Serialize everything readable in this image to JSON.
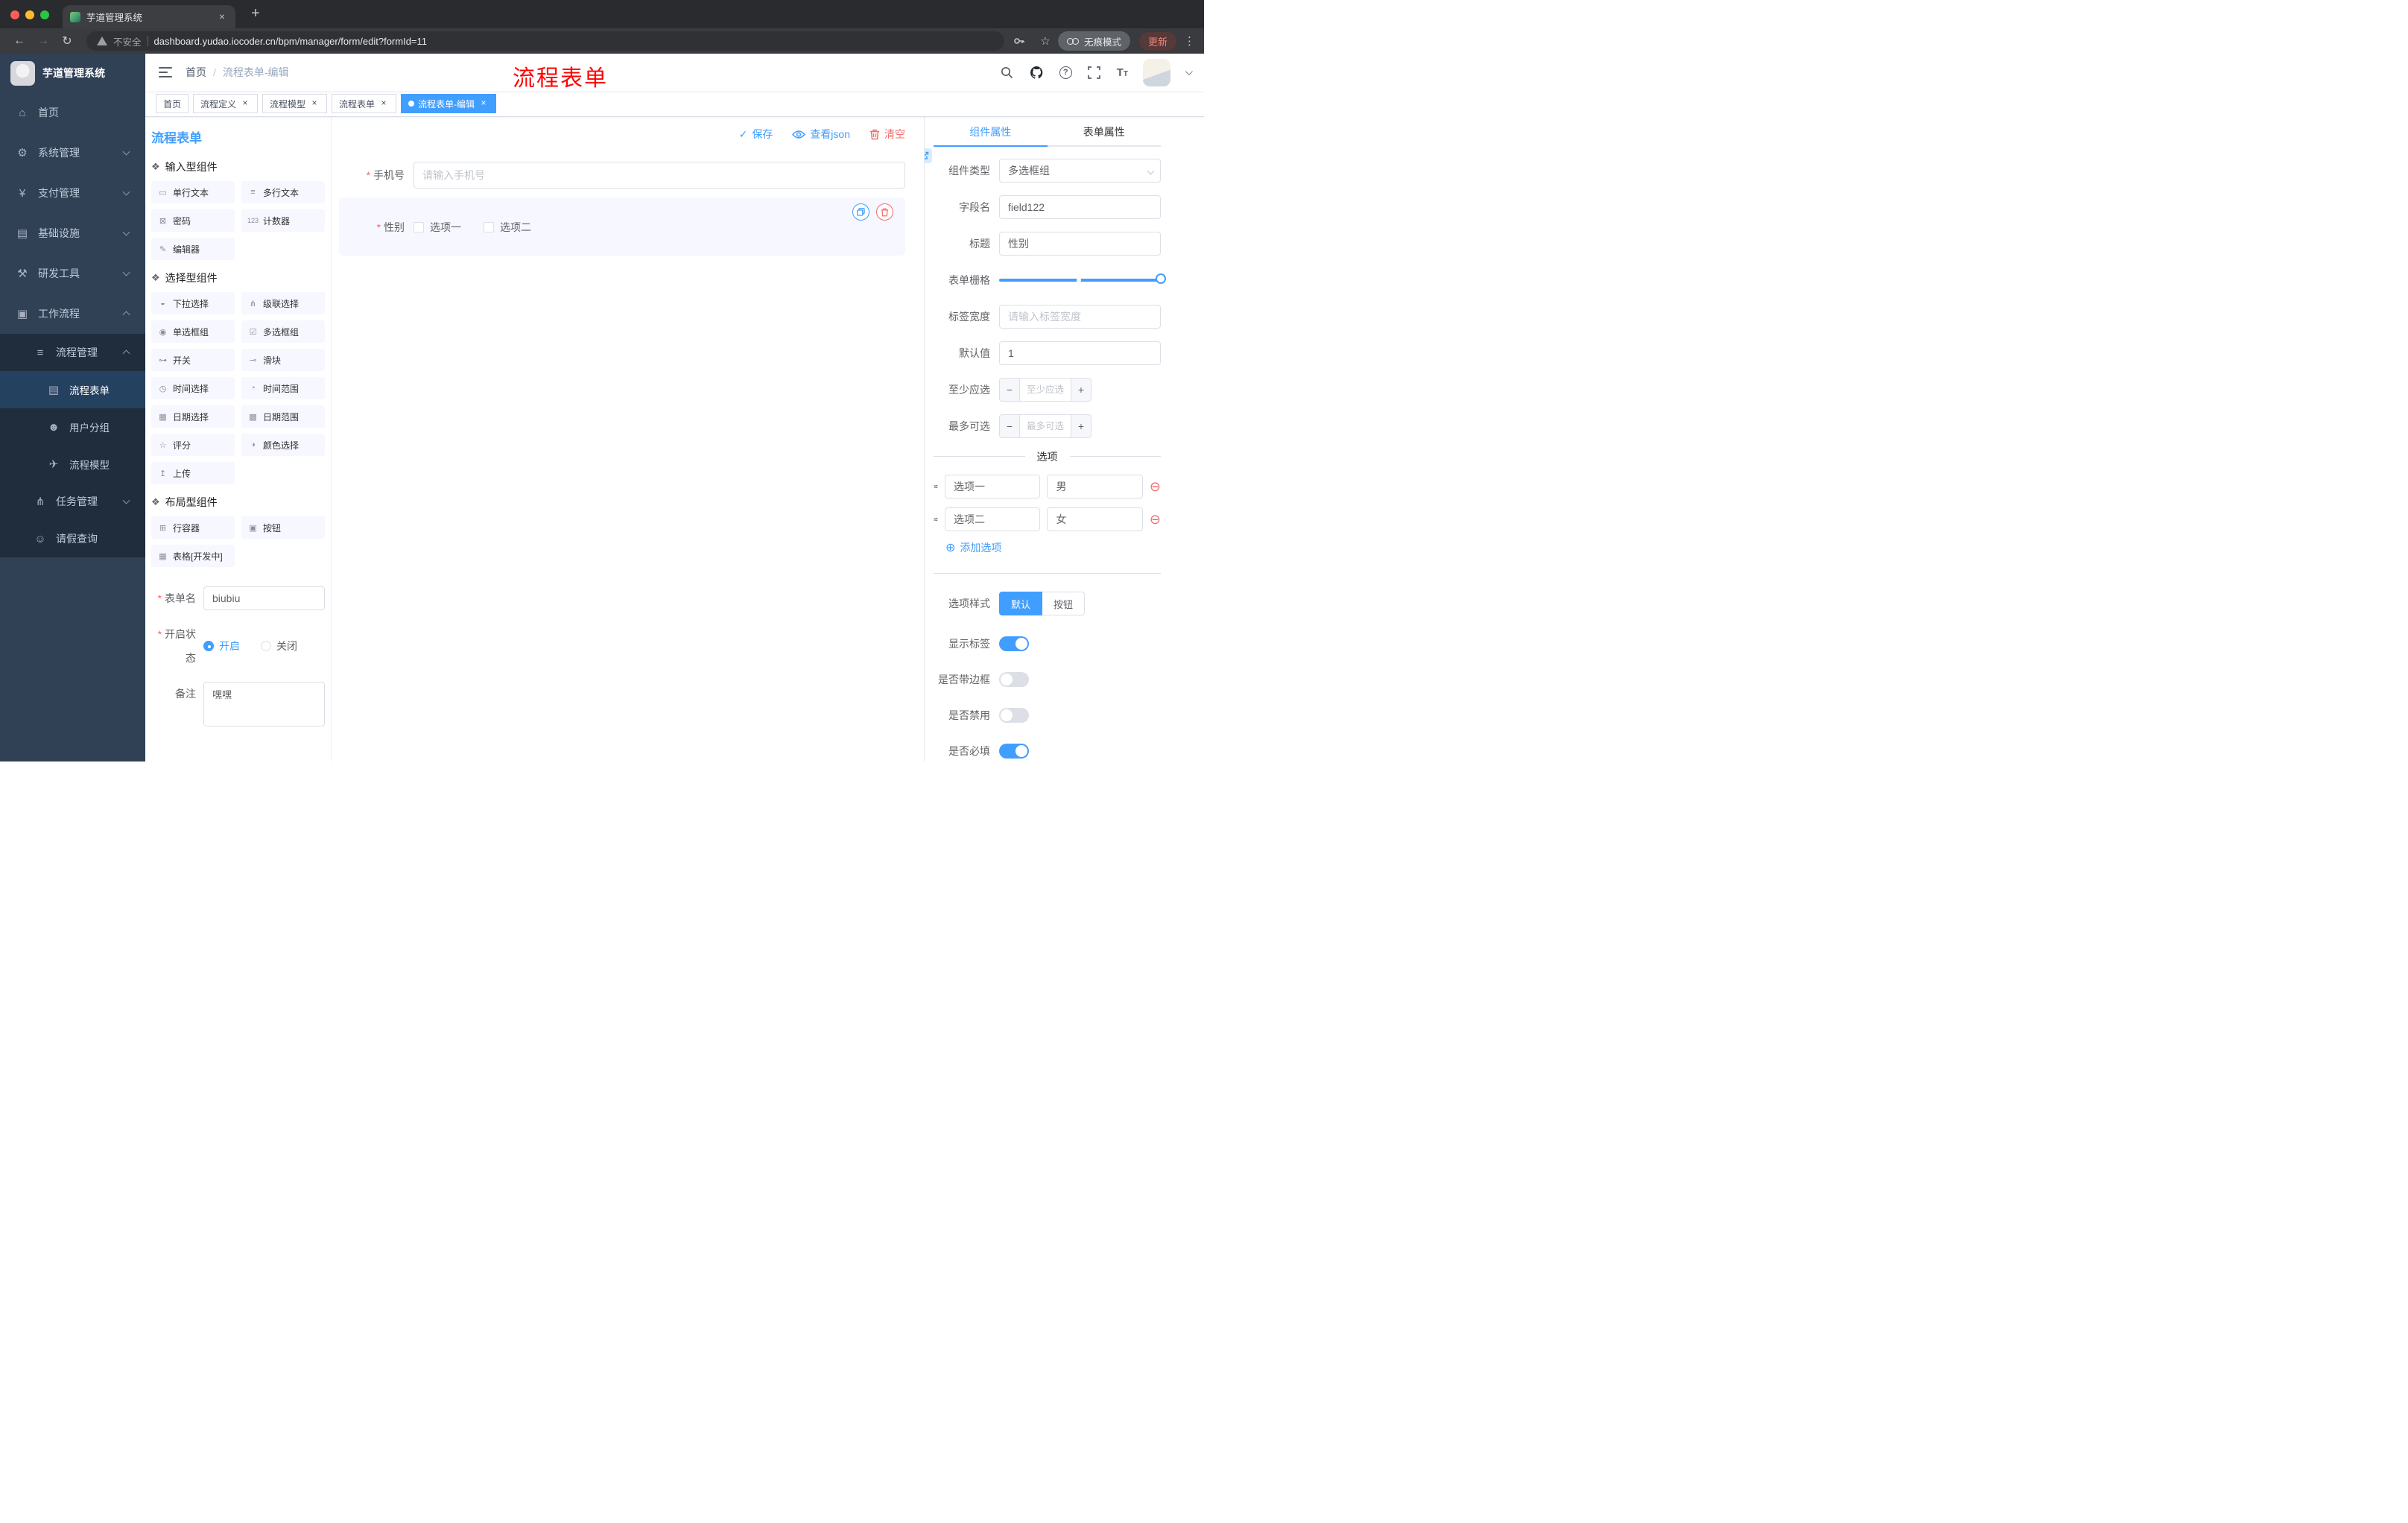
{
  "browser": {
    "tab_title": "芋道管理系统",
    "security_label": "不安全",
    "url": "dashboard.yudao.iocoder.cn/bpm/manager/form/edit?formId=11",
    "incognito_label": "无痕模式",
    "update_label": "更新"
  },
  "sidebar": {
    "logo_title": "芋道管理系统",
    "menu": [
      {
        "label": "首页"
      },
      {
        "label": "系统管理"
      },
      {
        "label": "支付管理"
      },
      {
        "label": "基础设施"
      },
      {
        "label": "研发工具"
      },
      {
        "label": "工作流程"
      },
      {
        "label": "流程管理"
      },
      {
        "label": "流程表单"
      },
      {
        "label": "用户分组"
      },
      {
        "label": "流程模型"
      },
      {
        "label": "任务管理"
      },
      {
        "label": "请假查询"
      }
    ]
  },
  "navbar": {
    "breadcrumb_home": "首页",
    "breadcrumb_current": "流程表单-编辑",
    "annotation": "流程表单"
  },
  "tags": [
    {
      "label": "首页"
    },
    {
      "label": "流程定义"
    },
    {
      "label": "流程模型"
    },
    {
      "label": "流程表单"
    },
    {
      "label": "流程表单-编辑"
    }
  ],
  "designer": {
    "panel_title": "流程表单",
    "save_label": "保存",
    "view_json_label": "查看json",
    "clear_label": "清空"
  },
  "palette": {
    "sections": [
      {
        "title": "输入型组件",
        "items": [
          {
            "label": "单行文本"
          },
          {
            "label": "多行文本"
          },
          {
            "label": "密码"
          },
          {
            "label": "计数器"
          },
          {
            "label": "编辑器"
          }
        ]
      },
      {
        "title": "选择型组件",
        "items": [
          {
            "label": "下拉选择"
          },
          {
            "label": "级联选择"
          },
          {
            "label": "单选框组"
          },
          {
            "label": "多选框组"
          },
          {
            "label": "开关"
          },
          {
            "label": "滑块"
          },
          {
            "label": "时间选择"
          },
          {
            "label": "时间范围"
          },
          {
            "label": "日期选择"
          },
          {
            "label": "日期范围"
          },
          {
            "label": "评分"
          },
          {
            "label": "颜色选择"
          },
          {
            "label": "上传"
          }
        ]
      },
      {
        "title": "布局型组件",
        "items": [
          {
            "label": "行容器"
          },
          {
            "label": "按钮"
          },
          {
            "label": "表格[开发中]"
          }
        ]
      }
    ],
    "form": {
      "name_label": "表单名",
      "name_value": "biubiu",
      "status_label": "开启状态",
      "status_on": "开启",
      "status_off": "关闭",
      "remark_label": "备注",
      "remark_value": "嘿嘿"
    }
  },
  "canvas": {
    "phone_label": "手机号",
    "phone_placeholder": "请输入手机号",
    "gender_label": "性别",
    "gender_option1": "选项一",
    "gender_option2": "选项二"
  },
  "inspector": {
    "tab_component": "组件属性",
    "tab_form": "表单属性",
    "component_type_label": "组件类型",
    "component_type_value": "多选框组",
    "field_name_label": "字段名",
    "field_name_value": "field122",
    "title_label": "标题",
    "title_value": "性别",
    "grid_label": "表单栅格",
    "label_width_label": "标签宽度",
    "label_width_placeholder": "请输入标签宽度",
    "default_label": "默认值",
    "default_value": "1",
    "min_label": "至少应选",
    "min_placeholder": "至少应选",
    "max_label": "最多可选",
    "max_placeholder": "最多可选",
    "options_title": "选项",
    "options": [
      {
        "label": "选项一",
        "value": "男"
      },
      {
        "label": "选项二",
        "value": "女"
      }
    ],
    "add_option_label": "添加选项",
    "style_label": "选项样式",
    "style_default": "默认",
    "style_button": "按钮",
    "show_label_label": "显示标签",
    "border_label": "是否带边框",
    "disabled_label": "是否禁用",
    "required_label": "是否必填"
  },
  "colors": {
    "accent": "#409eff",
    "danger": "#f56c6c",
    "annotation_red": "#ff0000",
    "sidebar_bg": "#304156",
    "sidebar_submenu_bg": "#1f2d3d",
    "active_tag_bg": "#409eff"
  }
}
